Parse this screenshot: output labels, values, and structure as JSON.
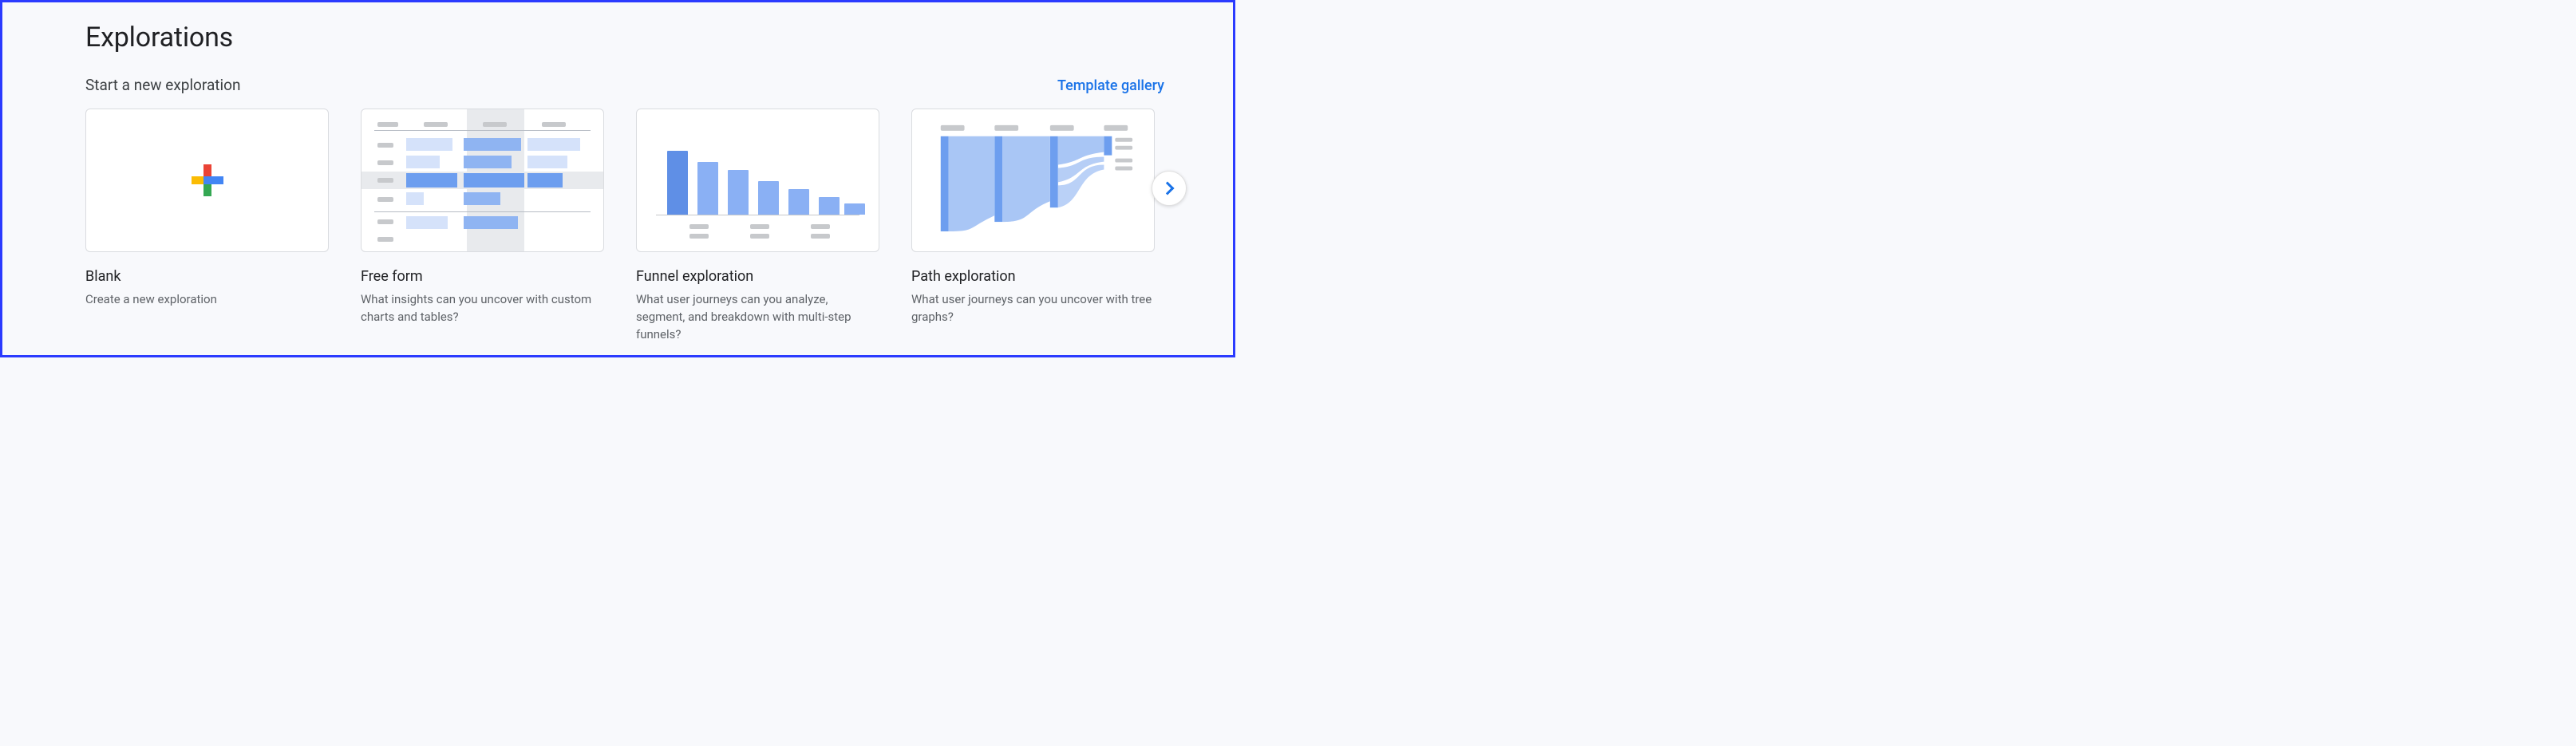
{
  "page": {
    "title": "Explorations"
  },
  "section": {
    "subtitle": "Start a new exploration",
    "gallery_link": "Template gallery"
  },
  "cards": {
    "blank": {
      "title": "Blank",
      "desc": "Create a new exploration"
    },
    "free_form": {
      "title": "Free form",
      "desc": "What insights can you uncover with custom charts and tables?"
    },
    "funnel": {
      "title": "Funnel exploration",
      "desc": "What user journeys can you analyze, segment, and breakdown with multi-step funnels?"
    },
    "path": {
      "title": "Path exploration",
      "desc": "What user journeys can you uncover with tree graphs?"
    }
  },
  "icons": {
    "plus": "plus-icon",
    "next": "chevron-right-icon"
  }
}
